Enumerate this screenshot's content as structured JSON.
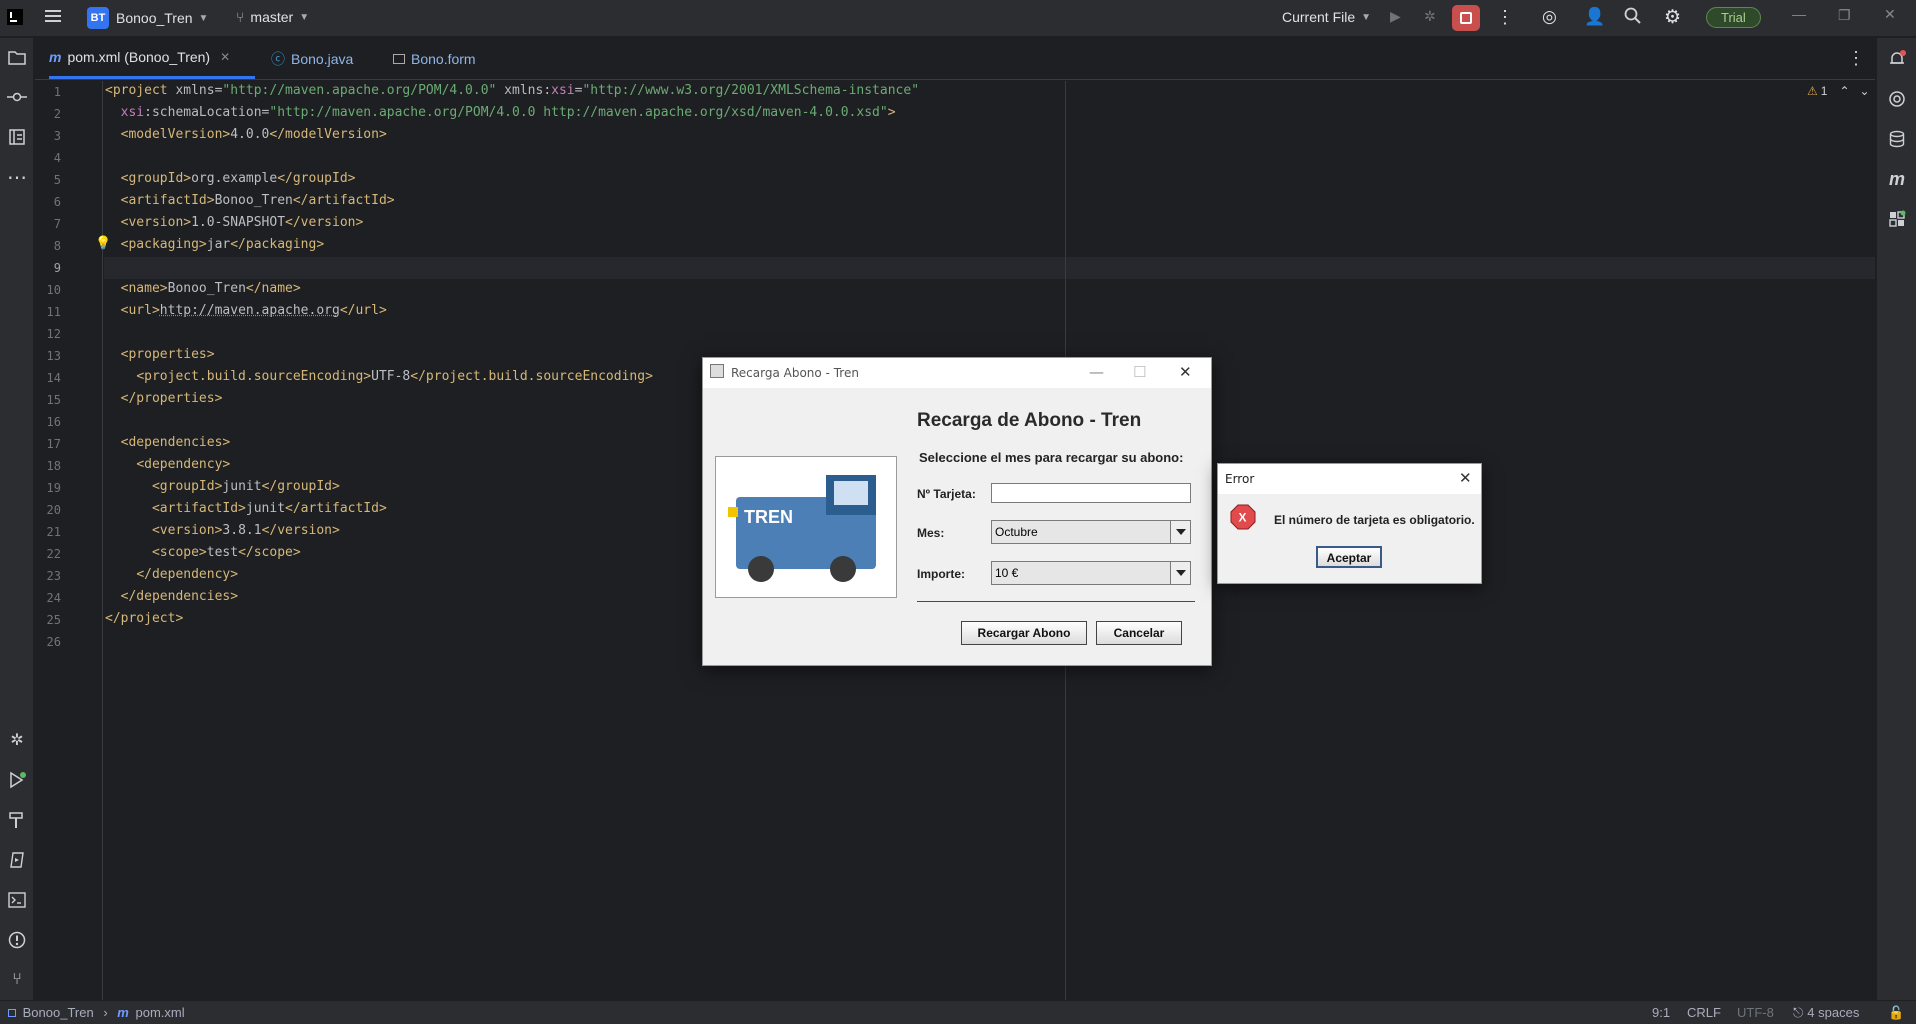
{
  "titlebar": {
    "project_initials": "BT",
    "project_name": "Bonoo_Tren",
    "branch": "master",
    "run_config": "Current File",
    "trial": "Trial"
  },
  "tabs": [
    {
      "label": "pom.xml (Bonoo_Tren)",
      "icon": "maven-icon",
      "active": true
    },
    {
      "label": "Bono.java",
      "icon": "class-icon"
    },
    {
      "label": "Bono.form",
      "icon": "form-icon"
    }
  ],
  "editor": {
    "inspections": "1",
    "line_numbers": [
      "1",
      "2",
      "3",
      "4",
      "5",
      "6",
      "7",
      "8",
      "9",
      "10",
      "11",
      "12",
      "13",
      "14",
      "15",
      "16",
      "17",
      "18",
      "19",
      "20",
      "21",
      "22",
      "23",
      "24",
      "25",
      "26"
    ]
  },
  "code": {
    "l1_tag": "<project",
    "l1_attr1": " xmlns=",
    "l1_val1": "\"http://maven.apache.org/POM/4.0.0\"",
    "l1_attr2": " xmlns:",
    "l1_ns2": "xsi",
    "l1_eq": "=",
    "l1_val2": "\"http://www.w3.org/2001/XMLSchema-instance\"",
    "l2_ns": "xsi",
    "l2_attr": ":schemaLocation=",
    "l2_val": "\"http://maven.apache.org/POM/4.0.0 http://maven.apache.org/xsd/maven-4.0.0.xsd\"",
    "l2_close": ">",
    "l3": [
      "<modelVersion>",
      "4.0.0",
      "</modelVersion>"
    ],
    "l5": [
      "<groupId>",
      "org.example",
      "</groupId>"
    ],
    "l6": [
      "<artifactId>",
      "Bonoo_Tren",
      "</artifactId>"
    ],
    "l7": [
      "<version>",
      "1.0-SNAPSHOT",
      "</version>"
    ],
    "l8": [
      "<packaging>",
      "jar",
      "</packaging>"
    ],
    "l10": [
      "<name>",
      "Bonoo_Tren",
      "</name>"
    ],
    "l11": [
      "<url>",
      "http://maven.apache.org",
      "</url>"
    ],
    "l13": "<properties>",
    "l14": [
      "<project.build.sourceEncoding>",
      "UTF-8",
      "</project.build.sourceEncoding>"
    ],
    "l15": "</properties>",
    "l17": "<dependencies>",
    "l18": "<dependency>",
    "l19": [
      "<groupId>",
      "junit",
      "</groupId>"
    ],
    "l20": [
      "<artifactId>",
      "junit",
      "</artifactId>"
    ],
    "l21": [
      "<version>",
      "3.8.1",
      "</version>"
    ],
    "l22": [
      "<scope>",
      "test",
      "</scope>"
    ],
    "l23": "</dependency>",
    "l24": "</dependencies>",
    "l25": "</project>"
  },
  "statusbar": {
    "breadcrumb_project": "Bonoo_Tren",
    "breadcrumb_file": "pom.xml",
    "position": "9:1",
    "line_sep": "CRLF",
    "encoding": "UTF-8",
    "indent": "4 spaces"
  },
  "dialog": {
    "title": "Recarga Abono - Tren",
    "heading": "Recarga de Abono - Tren",
    "subheading": "Seleccione el mes para recargar su abono:",
    "image_text": "TREN",
    "card_label": "Nº Tarjeta:",
    "card_value": "",
    "month_label": "Mes:",
    "month_value": "Octubre",
    "amount_label": "Importe:",
    "amount_value": "10 €",
    "recharge_button": "Recargar Abono",
    "cancel_button": "Cancelar"
  },
  "error": {
    "title": "Error",
    "icon_text": "X",
    "message": "El número de tarjeta es obligatorio.",
    "ok_button": "Aceptar"
  }
}
